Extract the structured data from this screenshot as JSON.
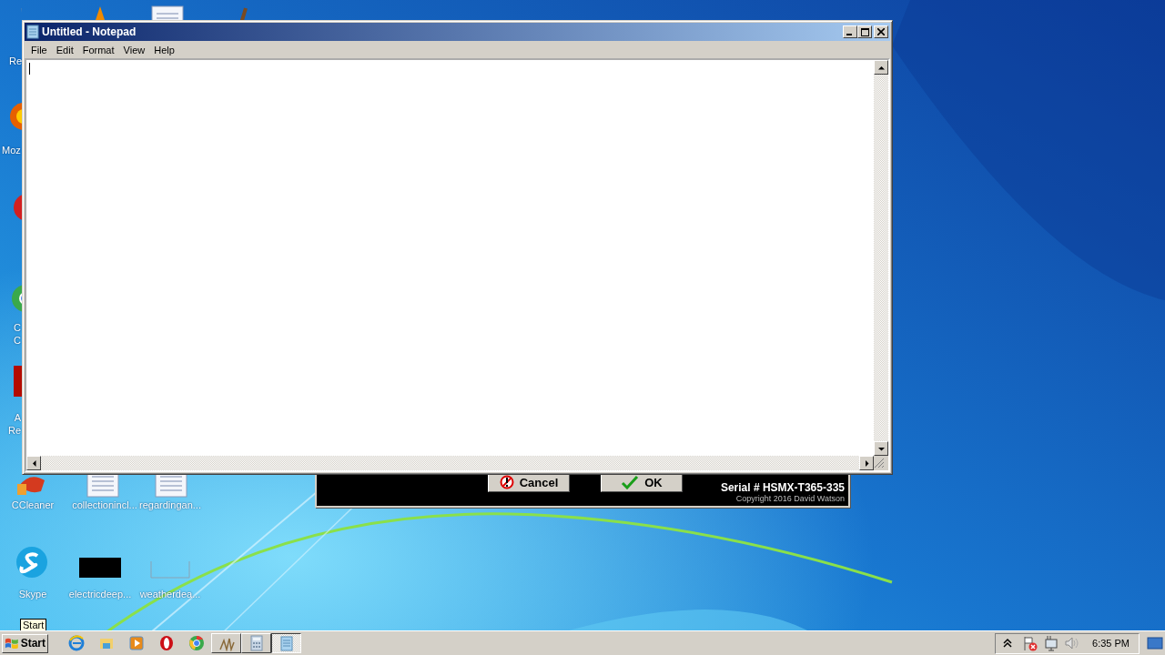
{
  "desktop_icons": [
    {
      "kind": "recycle",
      "lines": [
        "Re"
      ]
    },
    {
      "kind": "firefox",
      "lines": [
        "Moz"
      ]
    },
    {
      "kind": "redapp"
    },
    {
      "kind": "chrome",
      "lines": [
        "C",
        "C"
      ]
    },
    {
      "kind": "acrobat",
      "lines": [
        "A",
        "Re"
      ]
    },
    {
      "kind": "cleaner",
      "lines": [
        "CCleaner"
      ]
    },
    {
      "kind": "document",
      "lines": [
        "collectionincl..."
      ]
    },
    {
      "kind": "document",
      "lines": [
        "regardingan..."
      ]
    },
    {
      "kind": "skype",
      "lines": [
        "Skype"
      ]
    },
    {
      "kind": "blackfile",
      "lines": [
        "electricdeep..."
      ]
    },
    {
      "kind": "blankfile",
      "lines": [
        "weatherdea..."
      ]
    },
    {
      "kind": "cone"
    },
    {
      "kind": "document"
    },
    {
      "kind": "brush"
    }
  ],
  "dialog": {
    "buttons": [
      {
        "label": "Cancel",
        "kind": "cancel"
      },
      {
        "label": "OK",
        "kind": "ok"
      }
    ],
    "serial": "Serial # HSMX-T365-335",
    "copyright": "Copyright 2016 David Watson"
  },
  "window": {
    "title": "Untitled - Notepad",
    "menu": [
      "File",
      "Edit",
      "Format",
      "View",
      "Help"
    ]
  },
  "taskbar": {
    "start": "Start",
    "tooltip": "Start",
    "items": [
      {
        "kind": "ie",
        "selected": false
      },
      {
        "kind": "folder",
        "selected": false
      },
      {
        "kind": "media",
        "selected": false
      },
      {
        "kind": "opera",
        "selected": false
      },
      {
        "kind": "chrome",
        "selected": false
      },
      {
        "kind": "nts",
        "selected": false,
        "button": true
      },
      {
        "kind": "calc",
        "selected": false,
        "button": true
      },
      {
        "kind": "notepad",
        "selected": true,
        "button": true
      }
    ],
    "tray": [
      {
        "kind": "chevron"
      },
      {
        "kind": "flag"
      },
      {
        "kind": "network"
      },
      {
        "kind": "speaker"
      }
    ],
    "clock": "6:35 PM"
  }
}
